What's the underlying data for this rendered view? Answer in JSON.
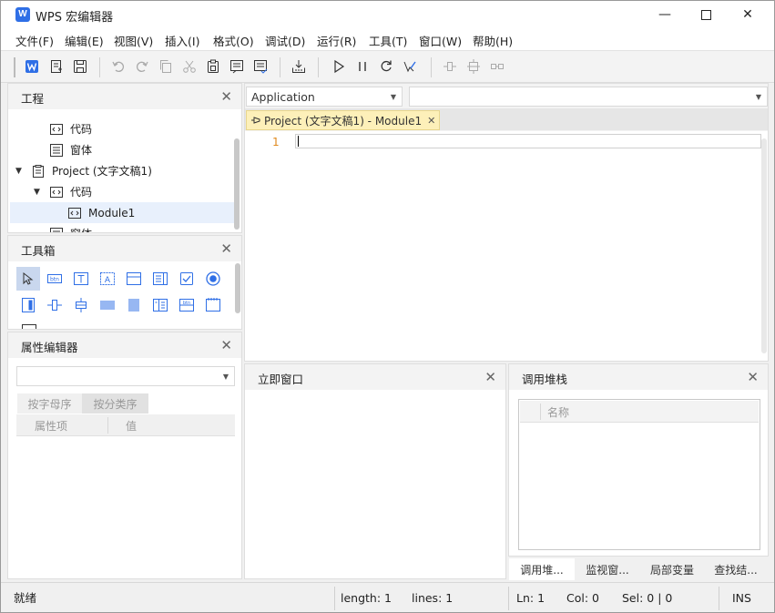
{
  "window": {
    "title": "WPS 宏编辑器",
    "logo_letter": "W",
    "minimize": "—",
    "maximize": "☐",
    "close": "✕"
  },
  "menu": [
    "文件(F)",
    "编辑(E)",
    "视图(V)",
    "插入(I)",
    "格式(O)",
    "调试(D)",
    "运行(R)",
    "工具(T)",
    "窗口(W)",
    "帮助(H)"
  ],
  "project_panel": {
    "title": "工程",
    "close": "✕",
    "items": [
      {
        "label": "代码",
        "icon": "code-module-icon"
      },
      {
        "label": "窗体",
        "icon": "form-icon"
      },
      {
        "label": "Project (文字文稿1)",
        "icon": "project-icon",
        "expanded": true
      },
      {
        "label": "代码",
        "icon": "code-module-icon",
        "expanded": true
      },
      {
        "label": "Module1",
        "icon": "module-icon",
        "selected": true
      },
      {
        "label": "窗体",
        "icon": "form-icon"
      }
    ]
  },
  "toolbox_panel": {
    "title": "工具箱",
    "close": "✕"
  },
  "property_panel": {
    "title": "属性编辑器",
    "close": "✕",
    "tabs": [
      "按字母序",
      "按分类序"
    ],
    "columns": [
      "属性项",
      "值"
    ]
  },
  "editor": {
    "object_dropdown": "Application",
    "proc_dropdown": "",
    "tab_label": "Project (文字文稿1) - Module1",
    "tab_close": "✕",
    "line_number": "1"
  },
  "immediate_panel": {
    "title": "立即窗口",
    "close": "✕"
  },
  "callstack_panel": {
    "title": "调用堆栈",
    "close": "✕",
    "column": "名称",
    "bottom_tabs": [
      "调用堆...",
      "监视窗...",
      "局部变量",
      "查找结..."
    ]
  },
  "statusbar": {
    "state": "就绪",
    "length": "length: 1",
    "lines": "lines: 1",
    "ln": "Ln: 1",
    "col": "Col: 0",
    "sel": "Sel: 0 | 0",
    "mode": "INS"
  },
  "colors": {
    "accent": "#2f6fe6",
    "tab_active_bg": "#fdf0b9",
    "line_number": "#e08a1e"
  }
}
